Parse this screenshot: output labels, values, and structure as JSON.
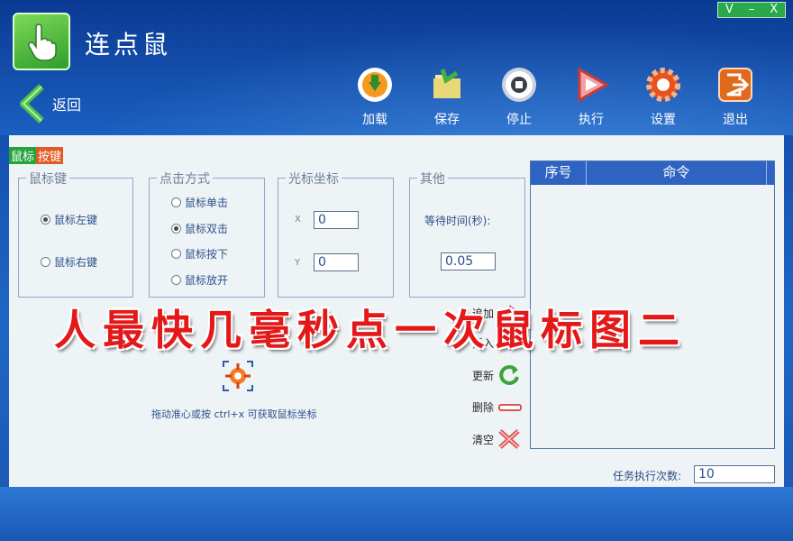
{
  "app": {
    "title": "连点鼠"
  },
  "window_controls": [
    "V",
    "–",
    "X"
  ],
  "back": {
    "label": "返回"
  },
  "toolbar": [
    {
      "label": "加载",
      "icon": "load-icon"
    },
    {
      "label": "保存",
      "icon": "save-icon"
    },
    {
      "label": "停止",
      "icon": "stop-icon"
    },
    {
      "label": "执行",
      "icon": "play-icon"
    },
    {
      "label": "设置",
      "icon": "gear-icon"
    },
    {
      "label": "退出",
      "icon": "exit-icon"
    }
  ],
  "tags": {
    "part1": "鼠标",
    "part2": "按键"
  },
  "mouse_key": {
    "legend": "鼠标键",
    "options": [
      "鼠标左键",
      "鼠标右键"
    ],
    "selected": 0
  },
  "click_mode": {
    "legend": "点击方式",
    "options": [
      "鼠标单击",
      "鼠标双击",
      "鼠标按下",
      "鼠标放开"
    ],
    "selected": 1
  },
  "cursor": {
    "legend": "光标坐标",
    "x_label": "X",
    "y_label": "Y",
    "x": "0",
    "y": "0"
  },
  "other": {
    "legend": "其他",
    "wait_label": "等待时间(秒):",
    "wait_value": "0.05"
  },
  "list": {
    "headers": [
      "序号",
      "命令"
    ]
  },
  "side_actions": [
    {
      "label": "追加",
      "icon": "append-icon"
    },
    {
      "label": "插入",
      "icon": "insert-icon"
    },
    {
      "label": "更新",
      "icon": "refresh-icon"
    },
    {
      "label": "删除",
      "icon": "delete-icon"
    },
    {
      "label": "清空",
      "icon": "clear-icon"
    }
  ],
  "banner": "人最快几毫秒点一次鼠标图二",
  "crosshair_tip": "拖动准心或按 ctrl+x 可获取鼠标坐标",
  "task": {
    "label": "任务执行次数:",
    "value": "10"
  }
}
